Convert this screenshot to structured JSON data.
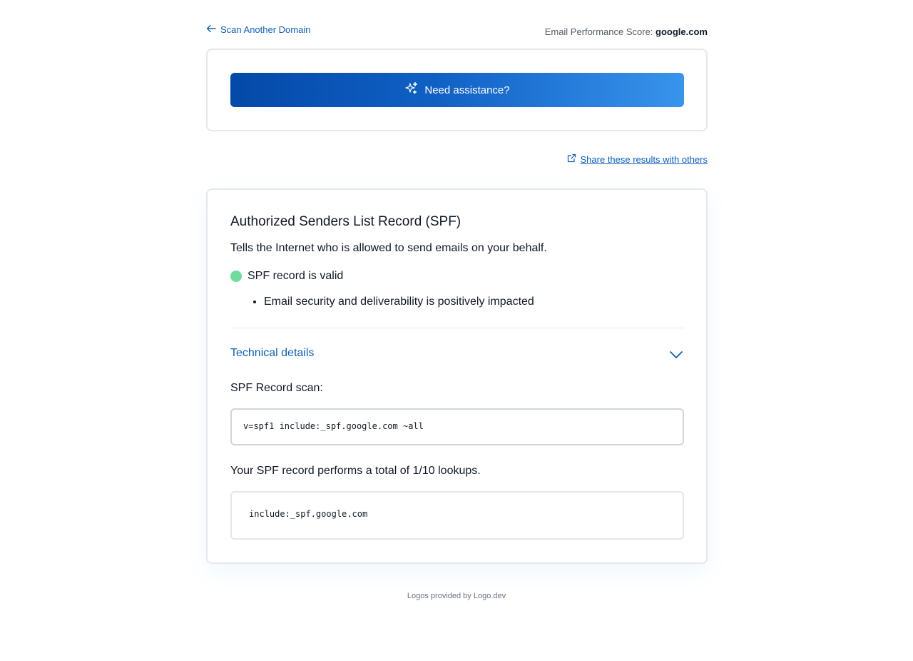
{
  "header": {
    "back_label": "Scan Another Domain",
    "score_label": "Email Performance Score:",
    "domain": "google.com"
  },
  "assist": {
    "button_label": "Need assistance?"
  },
  "share": {
    "label": "Share these results with others"
  },
  "spf": {
    "title": "Authorized Senders List Record (SPF)",
    "description": "Tells the Internet who is allowed to send emails on your behalf.",
    "status": "SPF record is valid",
    "status_color": "#6fdc9a",
    "impacts": [
      "Email security and deliverability is positively impacted"
    ],
    "technical_details_label": "Technical details",
    "scan_label": "SPF Record scan:",
    "record": "v=spf1 include:_spf.google.com ~all",
    "lookups_label": "Your SPF record performs a total of 1/10 lookups.",
    "lookups": [
      "include:_spf.google.com"
    ]
  },
  "footer": {
    "text": "Logos provided by Logo.dev"
  },
  "colors": {
    "link": "#0a5fbf",
    "gradient_start": "#0449a8",
    "gradient_end": "#3894ec"
  }
}
